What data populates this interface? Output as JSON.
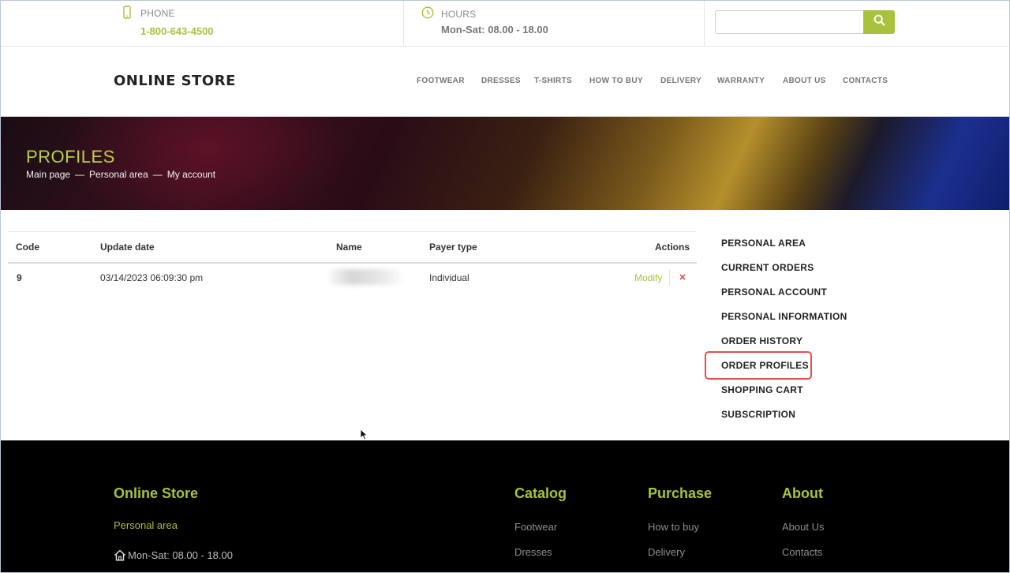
{
  "topbar": {
    "phone": {
      "icon": "phone-icon",
      "label": "PHONE",
      "value": "1-800-643-4500"
    },
    "hours": {
      "icon": "clock-icon",
      "label": "HOURS",
      "value": "Mon-Sat: 08.00 - 18.00"
    },
    "search": {
      "placeholder": "",
      "value": "",
      "button_icon": "search-icon"
    }
  },
  "header": {
    "logo": "ONLINE STORE",
    "nav": [
      "FOOTWEAR",
      "DRESSES",
      "T-SHIRTS",
      "HOW TO BUY",
      "DELIVERY",
      "WARRANTY",
      "ABOUT US",
      "CONTACTS"
    ]
  },
  "banner": {
    "title": "PROFILES",
    "breadcrumbs": [
      "Main page",
      "Personal area",
      "My account"
    ],
    "separator": "—"
  },
  "table": {
    "headers": [
      "Code",
      "Update date",
      "Name",
      "Payer type",
      "Actions"
    ],
    "rows": [
      {
        "code": "9",
        "update_date": "03/14/2023 06:09:30 pm",
        "name": "",
        "payer_type": "Individual",
        "action_modify": "Modify",
        "action_delete_icon": "close-icon"
      }
    ]
  },
  "sidebar": {
    "items": [
      "PERSONAL AREA",
      "CURRENT ORDERS",
      "PERSONAL ACCOUNT",
      "PERSONAL INFORMATION",
      "ORDER HISTORY",
      "ORDER PROFILES",
      "SHOPPING CART",
      "SUBSCRIPTION"
    ],
    "highlighted": "ORDER PROFILES"
  },
  "footer": {
    "brand": {
      "title": "Online Store",
      "personal_area": "Personal area",
      "hours": "Mon-Sat: 08.00 - 18.00",
      "hours_icon": "home-icon"
    },
    "catalog": {
      "title": "Catalog",
      "links": [
        "Footwear",
        "Dresses"
      ]
    },
    "purchase": {
      "title": "Purchase",
      "links": [
        "How to buy",
        "Delivery"
      ]
    },
    "about": {
      "title": "About",
      "links": [
        "About Us",
        "Contacts"
      ]
    }
  },
  "colors": {
    "accent": "#a7c23d",
    "highlight": "#e3504a",
    "footer_bg": "#000000",
    "delete": "#e3504a"
  }
}
